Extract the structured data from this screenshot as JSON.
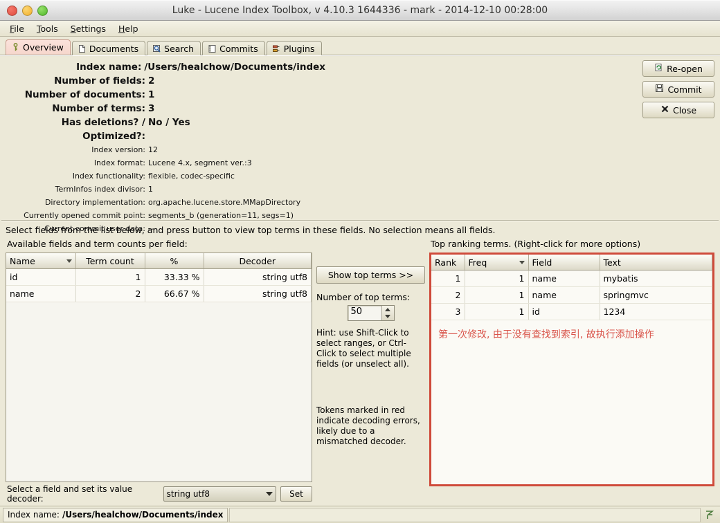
{
  "window": {
    "title": "Luke - Lucene Index Toolbox, v 4.10.3 1644336 - mark - 2014-12-10 00:28:00"
  },
  "menubar": {
    "items": [
      {
        "mnemonic": "F",
        "rest": "ile"
      },
      {
        "mnemonic": "T",
        "rest": "ools"
      },
      {
        "mnemonic": "S",
        "rest": "ettings"
      },
      {
        "mnemonic": "H",
        "rest": "elp"
      }
    ]
  },
  "tabs": [
    {
      "label": "Overview",
      "icon": "key-icon",
      "glyph": "⚘",
      "active": true
    },
    {
      "label": "Documents",
      "icon": "document-icon",
      "glyph": "὜B",
      "active": false
    },
    {
      "label": "Search",
      "icon": "magnifier-icon",
      "glyph": "ὐD",
      "active": false
    },
    {
      "label": "Commits",
      "icon": "book-icon",
      "glyph": "Ὅ3",
      "active": false
    },
    {
      "label": "Plugins",
      "icon": "plug-icon",
      "glyph": "⚙",
      "active": false
    }
  ],
  "overview": {
    "info": [
      {
        "label": "Index name:",
        "value": "/Users/healchow/Documents/index",
        "emphasis": "big"
      },
      {
        "label": "Number of fields:",
        "value": "2",
        "emphasis": "big"
      },
      {
        "label": "Number of documents:",
        "value": "1",
        "emphasis": "big"
      },
      {
        "label": "Number of terms:",
        "value": "3",
        "emphasis": "big"
      },
      {
        "label": "Has deletions? / Optimized?:",
        "value": "No  /  Yes",
        "emphasis": "big"
      },
      {
        "label": "Index version:",
        "value": "12",
        "emphasis": "small"
      },
      {
        "label": "Index format:",
        "value": "Lucene 4.x, segment ver.:3",
        "emphasis": "small"
      },
      {
        "label": "Index functionality:",
        "value": "flexible, codec-specific",
        "emphasis": "small"
      },
      {
        "label": "TermInfos index divisor:",
        "value": "1",
        "emphasis": "small"
      },
      {
        "label": "Directory implementation:",
        "value": "org.apache.lucene.store.MMapDirectory",
        "emphasis": "small"
      },
      {
        "label": "Currently opened commit point:",
        "value": "segments_b (generation=11, segs=1)",
        "emphasis": "small"
      },
      {
        "label": "Current commit user data:",
        "value": "--",
        "emphasis": "small"
      }
    ],
    "buttons": [
      {
        "label": "Re-open",
        "icon": "refresh-page-icon",
        "glyph": "↻"
      },
      {
        "label": "Commit",
        "icon": "save-disk-icon",
        "glyph": "ὋE"
      },
      {
        "label": "Close",
        "icon": "close-x-icon",
        "glyph": "✖"
      }
    ],
    "instruction": "Select fields from the list below, and press button to view top terms in these fields. No selection means all fields.",
    "fields_label": "Available fields and term counts per field:",
    "fields_table": {
      "columns": [
        "Name",
        "Term count",
        "%",
        "Decoder"
      ],
      "sorted_column": "Name",
      "rows": [
        {
          "name": "id",
          "term_count": "1",
          "percent": "33.33 %",
          "decoder": "string utf8"
        },
        {
          "name": "name",
          "term_count": "2",
          "percent": "66.67 %",
          "decoder": "string utf8"
        }
      ]
    },
    "middle": {
      "show_top_terms_button": "Show top terms >>",
      "num_top_terms_label": "Number of top terms:",
      "num_top_terms_value": "50",
      "hint_1": "Hint: use Shift-Click to select ranges, or Ctrl-Click to select multiple fields (or unselect all).",
      "hint_2": "Tokens marked in red indicate decoding errors, likely due to a mismatched decoder."
    },
    "top_terms_label": "Top ranking terms. (Right-click for more options)",
    "top_terms_table": {
      "columns": [
        "Rank",
        "Freq",
        "Field",
        "Text"
      ],
      "sorted_column": "Freq",
      "highlight_color": "#cf4a3a",
      "rows": [
        {
          "rank": "1",
          "freq": "1",
          "field": "name",
          "text": "mybatis"
        },
        {
          "rank": "2",
          "freq": "1",
          "field": "name",
          "text": "springmvc"
        },
        {
          "rank": "3",
          "freq": "1",
          "field": "id",
          "text": "1234"
        }
      ]
    },
    "annotation": {
      "text": "第一次修改, 由于没有查找到索引, 故执行添加操作",
      "color": "#d9544a"
    },
    "decoder_row": {
      "label": "Select a field and set its value decoder:",
      "selected": "string utf8",
      "set_button": "Set"
    }
  },
  "statusbar": {
    "label": "Index name:",
    "path": "/Users/healchow/Documents/index",
    "corner_icon": "luke-logo-icon",
    "corner_glyph": "⸛"
  }
}
